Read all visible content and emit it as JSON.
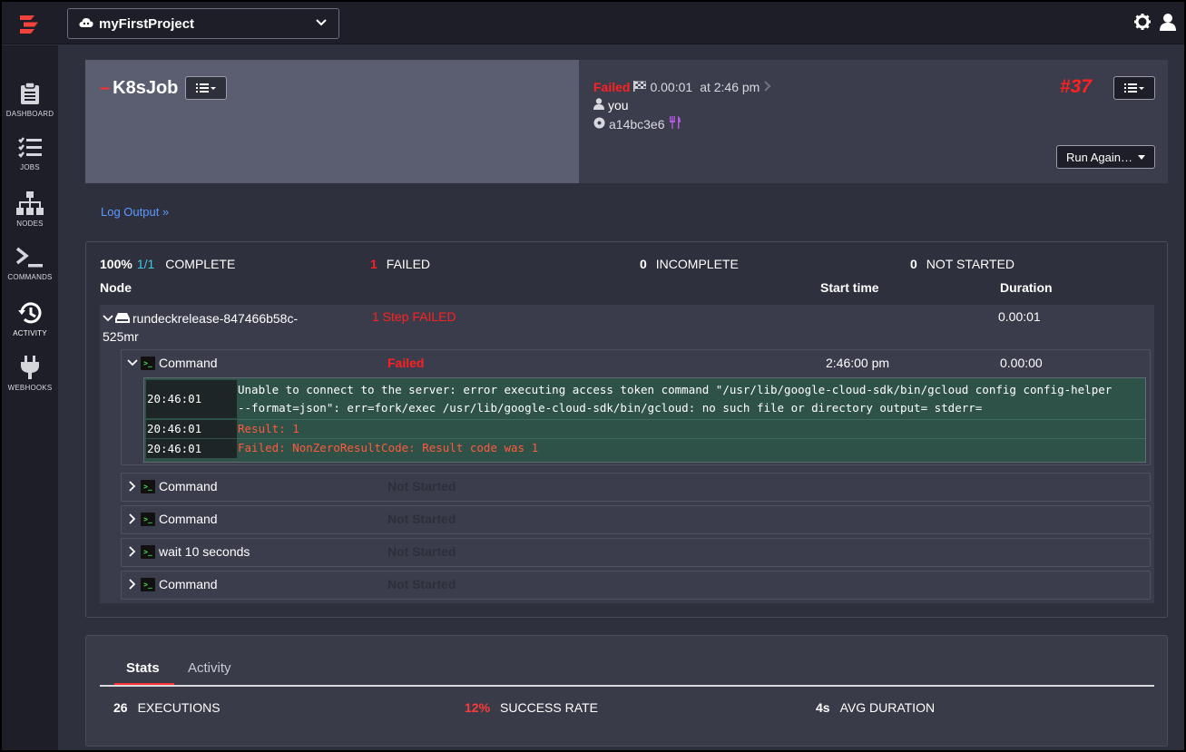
{
  "app": {
    "project_name": "myFirstProject"
  },
  "sidebar": {
    "items": [
      {
        "label": "DASHBOARD",
        "icon": "clipboard-icon"
      },
      {
        "label": "JOBS",
        "icon": "list-check-icon"
      },
      {
        "label": "NODES",
        "icon": "sitemap-icon"
      },
      {
        "label": "COMMANDS",
        "icon": "terminal-icon"
      },
      {
        "label": "ACTIVITY",
        "icon": "history-icon"
      },
      {
        "label": "WEBHOOKS",
        "icon": "plug-icon"
      }
    ]
  },
  "execution": {
    "job_dash": "–",
    "job_name": "K8sJob",
    "status": "Failed",
    "duration": "0.00:01",
    "at_time": "at 2:46 pm",
    "user": "you",
    "commit": "a14bc3e6",
    "number": "#37",
    "run_again_label": "Run Again…"
  },
  "log_link": "Log Output »",
  "summary": {
    "complete_pct": "100%",
    "complete_ratio": "1/1",
    "complete_label": "COMPLETE",
    "failed_count": "1",
    "failed_label": "FAILED",
    "incomplete_count": "0",
    "incomplete_label": "INCOMPLETE",
    "not_started_count": "0",
    "not_started_label": "NOT STARTED"
  },
  "table_headers": {
    "node": "Node",
    "start_time": "Start time",
    "duration": "Duration"
  },
  "node": {
    "name": "rundeckrelease-847466b58c-525mr",
    "status": "1 Step FAILED",
    "duration": "0.00:01"
  },
  "steps": [
    {
      "title": "Command",
      "status": "Failed",
      "start": "2:46:00 pm",
      "duration": "0.00:00"
    },
    {
      "title": "Command",
      "status": "Not Started"
    },
    {
      "title": "Command",
      "status": "Not Started"
    },
    {
      "title": "wait 10 seconds",
      "status": "Not Started"
    },
    {
      "title": "Command",
      "status": "Not Started"
    }
  ],
  "log": [
    {
      "time": "20:46:01",
      "msg_line1": "Unable to connect to the server: error executing access token command \"/usr/lib/google-cloud-sdk/bin/gcloud config config-helper",
      "msg_line2": "--format=json\": err=fork/exec /usr/lib/google-cloud-sdk/bin/gcloud: no such file or directory output= stderr="
    },
    {
      "time": "20:46:01",
      "msg": "Result: 1"
    },
    {
      "time": "20:46:01",
      "msg": "Failed: NonZeroResultCode: Result code was 1"
    }
  ],
  "stats": {
    "tabs": [
      "Stats",
      "Activity"
    ],
    "executions_value": "26",
    "executions_label": "EXECUTIONS",
    "success_value": "12%",
    "success_label": "SUCCESS RATE",
    "avg_value": "4s",
    "avg_label": "AVG DURATION"
  },
  "colors": {
    "accent_red": "#ff2020",
    "link_blue": "#5b9aff",
    "ratio_cyan": "#3ec8e0",
    "log_bg": "#2e5248",
    "log_error": "#ff5a3c"
  }
}
